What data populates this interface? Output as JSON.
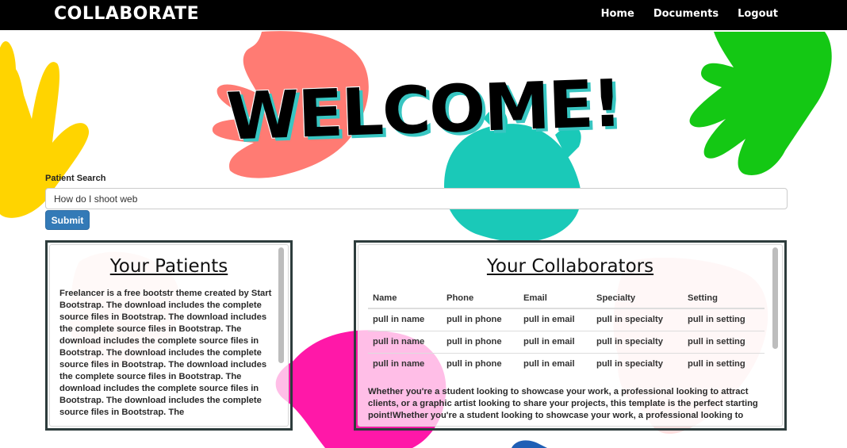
{
  "navbar": {
    "brand": "COLLABORATE",
    "links": [
      "Home",
      "Documents",
      "Logout"
    ]
  },
  "hero": {
    "title": "WELCOME!"
  },
  "search": {
    "label": "Patient Search",
    "value": "How do I shoot web",
    "submit_label": "Submit"
  },
  "patients": {
    "title": "Your Patients",
    "text": "Freelancer is a free bootstr theme created by Start Bootstrap. The download includes the complete source files in Bootstrap. The download includes the complete source files in Bootstrap. The download includes the complete source files in Bootstrap. The download includes the complete source files in Bootstrap. The download includes the complete source files in Bootstrap. The download includes the complete source files in Bootstrap. The download includes the complete source files in Bootstrap. The"
  },
  "collaborators": {
    "title": "Your Collaborators",
    "columns": [
      "Name",
      "Phone",
      "Email",
      "Specialty",
      "Setting"
    ],
    "rows": [
      [
        "pull in name",
        "pull in phone",
        "pull in email",
        "pull in specialty",
        "pull in setting"
      ],
      [
        "pull in name",
        "pull in phone",
        "pull in email",
        "pull in specialty",
        "pull in setting"
      ],
      [
        "pull in name",
        "pull in phone",
        "pull in email",
        "pull in specialty",
        "pull in setting"
      ]
    ],
    "text": "Whether you're a student looking to showcase your work, a professional looking to attract clients, or a graphic artist looking to share your projects, this template is the perfect starting point!Whether you're a student looking to showcase your work, a professional looking to"
  },
  "colors": {
    "navbar": "#000000",
    "accent_button": "#337ab7",
    "welcome_shadow": "#38c6c2",
    "hand_yellow": "#ffd400",
    "hand_red": "#ff7b73",
    "hand_teal": "#1ac9b8",
    "hand_green": "#14c814",
    "hand_magenta": "#ff18a8"
  }
}
